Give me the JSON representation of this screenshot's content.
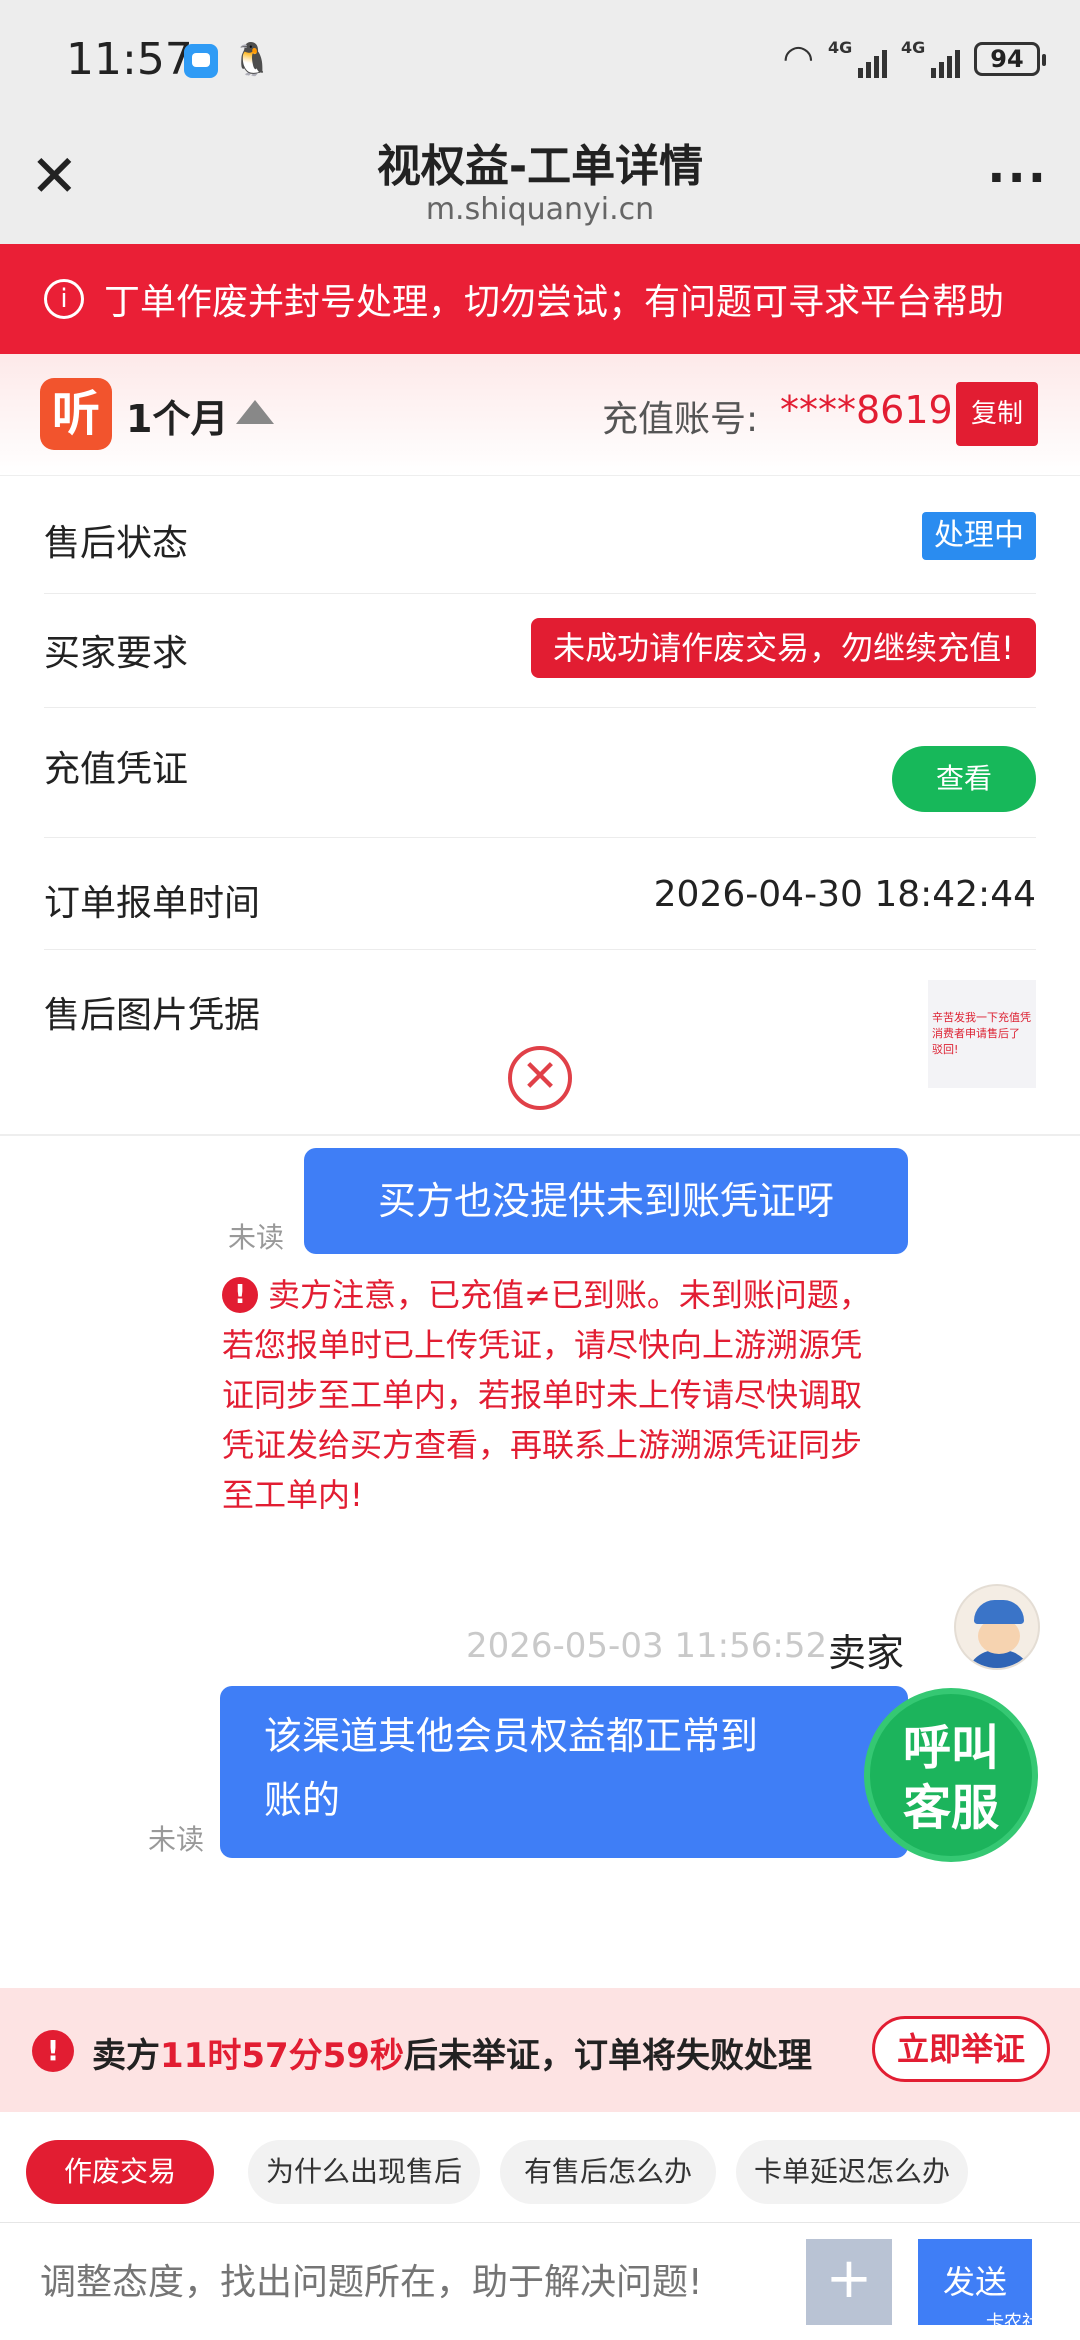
{
  "status_bar": {
    "time": "11:57",
    "wifi_icon": "wifi-icon",
    "signal1_label": "4G",
    "signal2_label": "4G",
    "battery": "94"
  },
  "nav": {
    "title": "视权益-工单详情",
    "url": "m.shiquanyi.cn",
    "close_icon": "close-icon",
    "more_icon": "more-icon"
  },
  "banner": {
    "text": "丁单作废并封号处理，切勿尝试；有问题可寻求平台帮助"
  },
  "product": {
    "logo_char": "听",
    "name": "1个月",
    "account_label": "充值账号:",
    "account_value": "****8619",
    "copy_label": "复制"
  },
  "details": {
    "after_sale_status_label": "售后状态",
    "after_sale_status_value": "处理中",
    "buyer_request_label": "买家要求",
    "buyer_request_value": "未成功请作废交易，勿继续充值!",
    "voucher_label": "充值凭证",
    "voucher_button": "查看",
    "report_time_label": "订单报单时间",
    "report_time_value": "2026-04-30 18:42:44",
    "evidence_label": "售后图片凭据",
    "evidence_thumb_text": "辛苦发我一下充值凭 消费者申请售后了 驳回!"
  },
  "chat": {
    "msg1": {
      "status": "未读",
      "text": "买方也没提供未到账凭证呀"
    },
    "warning": "卖方注意，已充值≠已到账。未到账问题，若您报单时已上传凭证，请尽快向上游溯源凭证同步至工单内，若报单时未上传请尽快调取凭证发给买方查看，再联系上游溯源凭证同步至工单内!",
    "msg2": {
      "time": "2026-05-03 11:56:52",
      "sender": "卖家",
      "status": "未读",
      "text": "该渠道其他会员权益都正常到账的"
    },
    "call_service_line1": "呼叫",
    "call_service_line2": "客服"
  },
  "countdown": {
    "prefix": "卖方",
    "time": "11时57分59秒",
    "suffix": "后未举证，订单将失败处理",
    "button": "立即举证"
  },
  "quick_replies": [
    "作废交易",
    "为什么出现售后",
    "有售后怎么办",
    "卡单延迟怎么办"
  ],
  "input": {
    "placeholder": "调整态度，找出问题所在，助于解决问题!",
    "plus": "+",
    "send": "发送",
    "watermark": "卡农社"
  },
  "colors": {
    "brand_red": "#e21d32",
    "bubble_blue": "#3f7ef6",
    "status_blue": "#2a8cf0",
    "success_green": "#17b85a"
  }
}
